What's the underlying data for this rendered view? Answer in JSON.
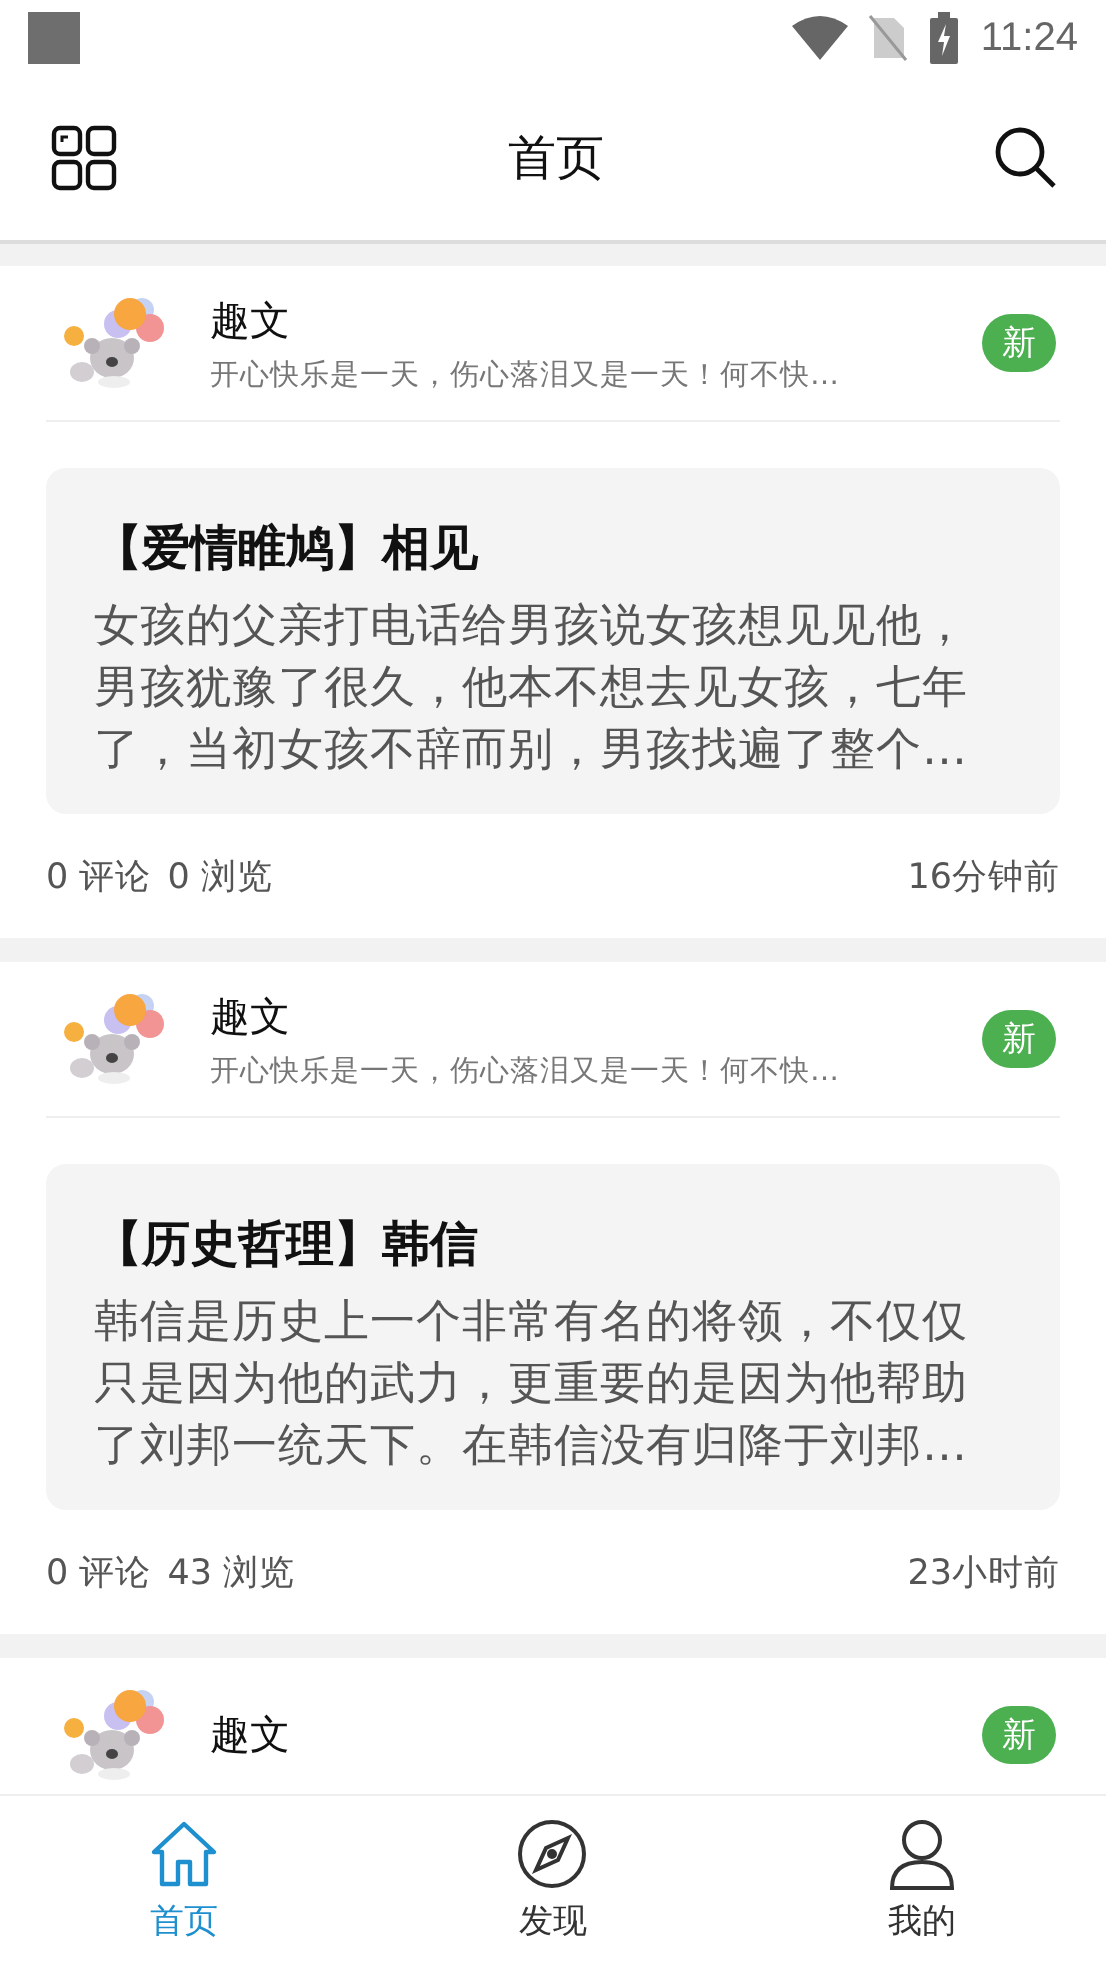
{
  "status_bar": {
    "time": "11:24"
  },
  "header": {
    "title": "首页"
  },
  "posts": [
    {
      "author": "趣文",
      "tagline": "开心快乐是一天，伤心落泪又是一天！何不快…",
      "badge": "新",
      "title": "【爱情睢鸠】相见",
      "excerpt": "女孩的父亲打电话给男孩说女孩想见见他，男孩犹豫了很久，他本不想去见女孩，七年了，当初女孩不辞而别，男孩找遍了整个…",
      "comments": "0 评论",
      "views": "0 浏览",
      "time": "16分钟前"
    },
    {
      "author": "趣文",
      "tagline": "开心快乐是一天，伤心落泪又是一天！何不快…",
      "badge": "新",
      "title": "【历史哲理】韩信",
      "excerpt": "韩信是历史上一个非常有名的将领，不仅仅只是因为他的武力，更重要的是因为他帮助了刘邦一统天下。在韩信没有归降于刘邦…",
      "comments": "0 评论",
      "views": "43 浏览",
      "time": "23小时前"
    },
    {
      "author": "趣文",
      "badge": "新"
    }
  ],
  "nav": [
    {
      "kind": "home",
      "label": "首页",
      "selected": true
    },
    {
      "kind": "compass",
      "label": "发现",
      "selected": false
    },
    {
      "kind": "person",
      "label": "我的",
      "selected": false
    }
  ]
}
